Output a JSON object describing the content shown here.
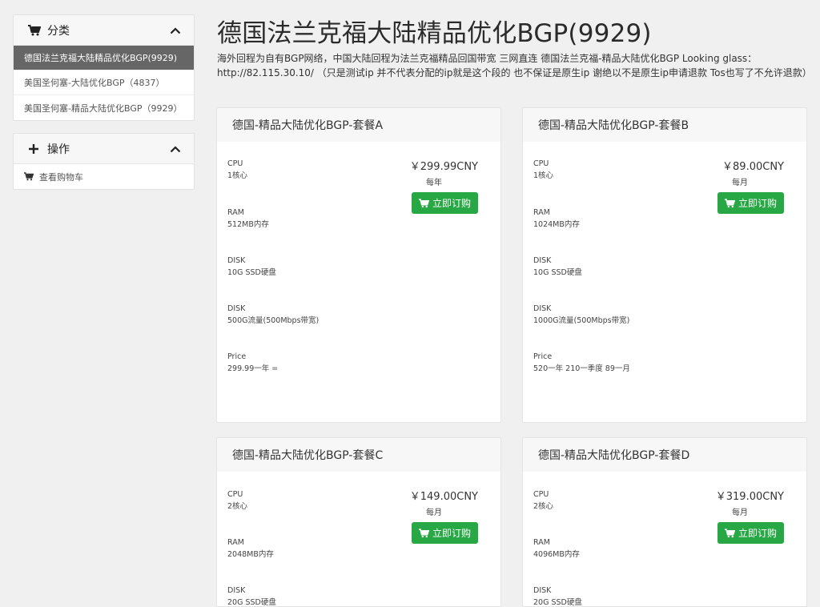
{
  "sidebar": {
    "categories": {
      "title": "分类",
      "items": [
        {
          "label": "德国法兰克福大陆精品优化BGP(9929)",
          "active": true
        },
        {
          "label": "美国圣何塞-大陆优化BGP（4837）",
          "active": false
        },
        {
          "label": "美国圣何塞-精品大陆优化BGP（9929）",
          "active": false
        }
      ]
    },
    "actions": {
      "title": "操作",
      "items": [
        {
          "label": "查看购物车"
        }
      ]
    }
  },
  "main": {
    "title": "德国法兰克福大陆精品优化BGP(9929)",
    "description": "海外回程为自有BGP网络，中国大陆回程为法兰克福精品回国带宽 三网直连 德国法兰克福-精品大陆优化BGP Looking glass：http://82.115.30.10/ （只是测试ip 并不代表分配的ip就是这个段的 也不保证是原生ip 谢绝以不是原生ip申请退款 Tos也写了不允许退款）"
  },
  "products": [
    {
      "name": "德国-精品大陆优化BGP-套餐A",
      "price": "￥299.99CNY",
      "cycle": "每年",
      "order_label": "立即订购",
      "specs": [
        {
          "label": "CPU",
          "value": "1核心"
        },
        {
          "label": "RAM",
          "value": "512MB内存"
        },
        {
          "label": "DISK",
          "value": "10G SSD硬盘"
        },
        {
          "label": "DISK",
          "value": "500G流量(500Mbps带宽)"
        },
        {
          "label": "Price",
          "value": "299.99一年 ="
        }
      ]
    },
    {
      "name": "德国-精品大陆优化BGP-套餐B",
      "price": "￥89.00CNY",
      "cycle": "每月",
      "order_label": "立即订购",
      "specs": [
        {
          "label": "CPU",
          "value": "1核心"
        },
        {
          "label": "RAM",
          "value": "1024MB内存"
        },
        {
          "label": "DISK",
          "value": "10G SSD硬盘"
        },
        {
          "label": "DISK",
          "value": "1000G流量(500Mbps带宽)"
        },
        {
          "label": "Price",
          "value": "520一年 210一季度 89一月"
        }
      ]
    },
    {
      "name": "德国-精品大陆优化BGP-套餐C",
      "price": "￥149.00CNY",
      "cycle": "每月",
      "order_label": "立即订购",
      "specs": [
        {
          "label": "CPU",
          "value": "2核心"
        },
        {
          "label": "RAM",
          "value": "2048MB内存"
        },
        {
          "label": "DISK",
          "value": "20G SSD硬盘"
        }
      ]
    },
    {
      "name": "德国-精品大陆优化BGP-套餐D",
      "price": "￥319.00CNY",
      "cycle": "每月",
      "order_label": "立即订购",
      "specs": [
        {
          "label": "CPU",
          "value": "2核心"
        },
        {
          "label": "RAM",
          "value": "4096MB内存"
        },
        {
          "label": "DISK",
          "value": "20G SSD硬盘"
        }
      ]
    }
  ],
  "colors": {
    "accent_green": "#28a745",
    "active_item_bg": "#666666"
  }
}
